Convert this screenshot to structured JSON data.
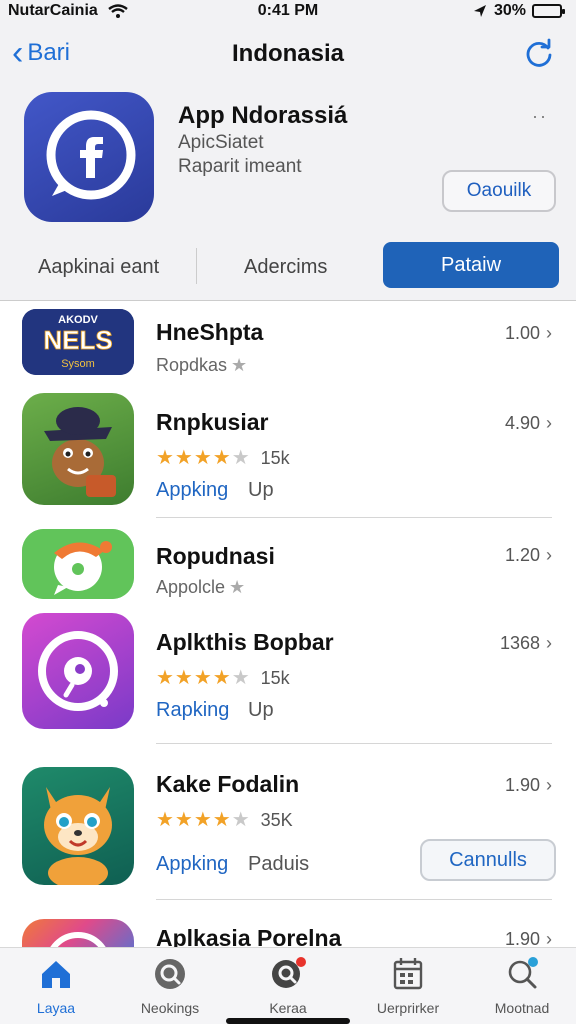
{
  "status": {
    "carrier": "NutarCainia",
    "time": "0:41 PM",
    "battery": "30%",
    "battery_level": 0.3
  },
  "nav": {
    "back_label": "Bari",
    "title": "Indonasia"
  },
  "hero": {
    "name": "App Ndorassiá",
    "subtitle1": "ApicSiatet",
    "subtitle2": "Raparit imeant",
    "more": "··",
    "open_label": "Oaouilk"
  },
  "segments": [
    "Aapkinai eant",
    "Adercims",
    "Pataiw"
  ],
  "apps": [
    {
      "icon_text_top": "AKODV",
      "icon_text_mid": "NELS",
      "icon_text_bot": "Sysom",
      "name": "HneShpta",
      "sub": "Ropdkas",
      "version": "1.00"
    },
    {
      "name": "Rnpkusiar",
      "rating": 3.5,
      "count": "15k",
      "action1": "Appking",
      "action2": "Up",
      "version": "4.90"
    },
    {
      "name": "Ropudnasi",
      "sub": "Appolcle",
      "version": "1.20"
    },
    {
      "name": "Aplkthis Bopbar",
      "rating": 3.5,
      "count": "15k",
      "action1": "Rapking",
      "action2": "Up",
      "version": "1368"
    },
    {
      "name": "Kake Fodalin",
      "rating": 3.5,
      "count": "35K",
      "action1": "Appking",
      "action2": "Paduis",
      "button": "Cannulls",
      "version": "1.90"
    },
    {
      "name": "Aplkasia Porelna",
      "version": "1.90"
    }
  ],
  "tabs": [
    {
      "label": "Layaa",
      "icon": "home-icon",
      "active": true
    },
    {
      "label": "Neokings",
      "icon": "search-app-icon",
      "active": false
    },
    {
      "label": "Keraa",
      "icon": "search-badge-icon",
      "active": false
    },
    {
      "label": "Uerprirker",
      "icon": "calendar-icon",
      "active": false
    },
    {
      "label": "Mootnad",
      "icon": "magnifier-icon",
      "active": false
    }
  ],
  "colors": {
    "accent": "#1f6fd6",
    "segment_active": "#1f63b8",
    "star": "#f2a227",
    "badge": "#e8332c"
  }
}
